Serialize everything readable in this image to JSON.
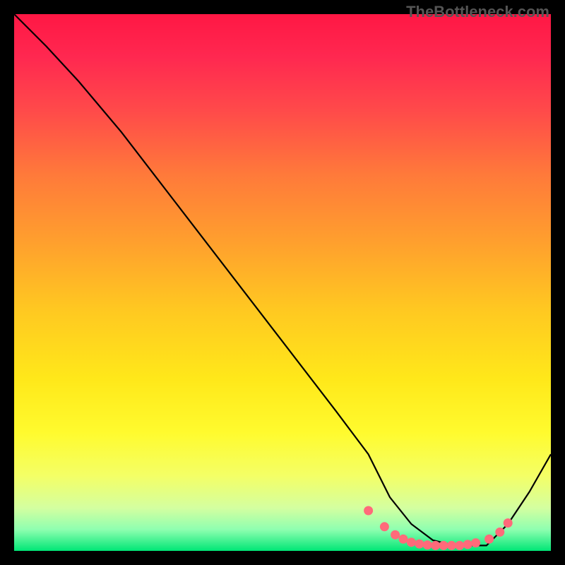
{
  "watermark": "TheBottleneck.com",
  "chart_data": {
    "type": "line",
    "title": "",
    "xlabel": "",
    "ylabel": "",
    "xlim": [
      0,
      100
    ],
    "ylim": [
      0,
      100
    ],
    "background_gradient": {
      "stops": [
        {
          "offset": 0.0,
          "color": "#ff1744"
        },
        {
          "offset": 0.08,
          "color": "#ff2850"
        },
        {
          "offset": 0.18,
          "color": "#ff4a4a"
        },
        {
          "offset": 0.3,
          "color": "#ff7a3a"
        },
        {
          "offset": 0.42,
          "color": "#ff9e2e"
        },
        {
          "offset": 0.55,
          "color": "#ffc821"
        },
        {
          "offset": 0.68,
          "color": "#ffe81a"
        },
        {
          "offset": 0.78,
          "color": "#fffb2e"
        },
        {
          "offset": 0.86,
          "color": "#f4ff66"
        },
        {
          "offset": 0.92,
          "color": "#d4ffa0"
        },
        {
          "offset": 0.96,
          "color": "#8fffb0"
        },
        {
          "offset": 1.0,
          "color": "#00e676"
        }
      ]
    },
    "series": [
      {
        "name": "curve",
        "stroke": "#000000",
        "x": [
          0,
          6,
          12,
          20,
          30,
          40,
          50,
          60,
          66,
          70,
          74,
          78,
          82,
          86,
          88,
          92,
          96,
          100
        ],
        "y": [
          100,
          94,
          87.5,
          78,
          65,
          52,
          39,
          26,
          18,
          10,
          5,
          2,
          1,
          1,
          1,
          5,
          11,
          18
        ]
      }
    ],
    "markers": {
      "name": "bottom-markers",
      "fill": "#ff6a7a",
      "x": [
        66,
        69,
        71,
        72.5,
        74,
        75.5,
        77,
        78.5,
        80,
        81.5,
        83,
        84.5,
        86,
        88.5,
        90.5,
        92
      ],
      "y": [
        7.5,
        4.5,
        3,
        2.2,
        1.6,
        1.3,
        1.1,
        1.0,
        1.0,
        1.0,
        1.0,
        1.2,
        1.5,
        2.2,
        3.5,
        5.2
      ]
    }
  }
}
